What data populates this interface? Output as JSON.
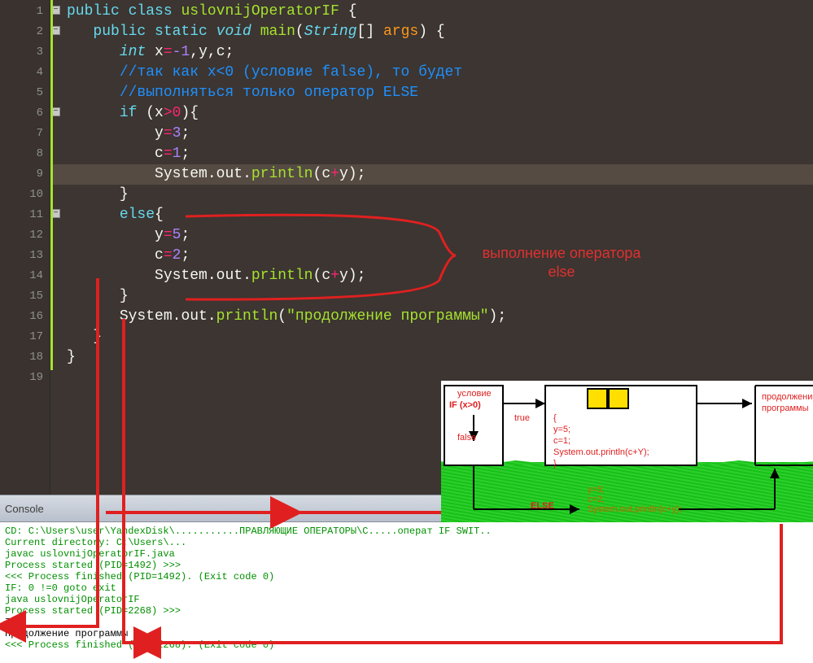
{
  "code": {
    "lines": [
      {
        "n": "1"
      },
      {
        "n": "2"
      },
      {
        "n": "3"
      },
      {
        "n": "4"
      },
      {
        "n": "5"
      },
      {
        "n": "6"
      },
      {
        "n": "7"
      },
      {
        "n": "8"
      },
      {
        "n": "9"
      },
      {
        "n": "10"
      },
      {
        "n": "11"
      },
      {
        "n": "12"
      },
      {
        "n": "13"
      },
      {
        "n": "14"
      },
      {
        "n": "15"
      },
      {
        "n": "16"
      },
      {
        "n": "17"
      },
      {
        "n": "18"
      },
      {
        "n": "19"
      }
    ],
    "tokens": {
      "public": "public",
      "class": "class",
      "classname": "uslovnijOperatorIF",
      "static": "static",
      "void": "void",
      "main": "main",
      "string": "String",
      "args": "args",
      "int": "int",
      "x": "x",
      "y": "y",
      "c": "c",
      "eq": "=",
      "minus1": "-1",
      "comma": ",",
      "semi": ";",
      "cmt1": "//так как x<0 (условие false), то будет",
      "cmt2": "//выполняться только оператор ELSE",
      "if": "if",
      "gt0": ">0",
      "num3": "3",
      "num1": "1",
      "system": "System",
      "out": "out",
      "println": "println",
      "plus": "+",
      "else": "else",
      "num5": "5",
      "num2": "2",
      "str_continue": "\"продолжение программы\"",
      "lparen": "(",
      "rparen": ")",
      "lbrace": "{",
      "rbrace": "}",
      "lbracket": "[",
      "rbracket": "]",
      "dot": "."
    }
  },
  "annotation": {
    "else_label_1": "выполнение оператора",
    "else_label_2": "else"
  },
  "diagram": {
    "uslovie": "условие",
    "if_cond": "IF (x>0)",
    "true": "true",
    "false": "false",
    "else": "ELSE",
    "body_open": "{",
    "body_y": "y=5;",
    "body_c": "c=1;",
    "body_print": "System.out.println(c+Y);",
    "body_close": "}",
    "continue1": "продолжение",
    "continue2": "программы",
    "else_y": "y=5;",
    "else_c": "c=2;",
    "else_print": "System.out.println(c+y);"
  },
  "console": {
    "label": "Console",
    "l1": "CD: C:\\Users\\user\\YandexDisk\\...........ПРАВЛЯЮЩИЕ ОПЕРАТОРЫ\\С.....операт IF SWIT..",
    "l2": "Current directory: C:\\Users\\...",
    "l3": "javac uslovnijOperatorIF.java",
    "l4": "Process started (PID=1492) >>>",
    "l5": "<<< Process finished (PID=1492). (Exit code 0)",
    "l6": "IF: 0 !=0 goto exit",
    "l7": "java uslovnijOperatorIF",
    "l8": "Process started (PID=2268) >>>",
    "l9": "7",
    "l10": "продолжение программы",
    "l11": "<<< Process finished (PID=2268). (Exit code 0)"
  }
}
